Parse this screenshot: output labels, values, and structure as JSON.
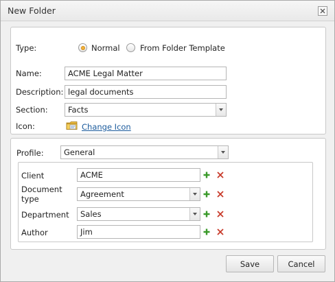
{
  "window": {
    "title": "New Folder"
  },
  "type": {
    "label": "Type:",
    "options": [
      {
        "label": "Normal",
        "selected": true
      },
      {
        "label": "From Folder Template",
        "selected": false
      }
    ]
  },
  "form": {
    "name": {
      "label": "Name:",
      "value": "ACME Legal Matter"
    },
    "description": {
      "label": "Description:",
      "value": "legal documents"
    },
    "section": {
      "label": "Section:",
      "value": "Facts"
    },
    "icon": {
      "label": "Icon:",
      "link": "Change Icon"
    }
  },
  "profile": {
    "label": "Profile:",
    "value": "General",
    "fields": [
      {
        "label": "Client",
        "value": "ACME",
        "type": "text"
      },
      {
        "label": "Document type",
        "value": "Agreement",
        "type": "combo"
      },
      {
        "label": "Department",
        "value": "Sales",
        "type": "combo"
      },
      {
        "label": "Author",
        "value": "Jim",
        "type": "text"
      }
    ]
  },
  "buttons": {
    "save": "Save",
    "cancel": "Cancel"
  },
  "colors": {
    "accent_radio": "#f0b13a",
    "link": "#1a5a9c",
    "add": "#3a9a2a",
    "remove": "#c83a2a"
  }
}
